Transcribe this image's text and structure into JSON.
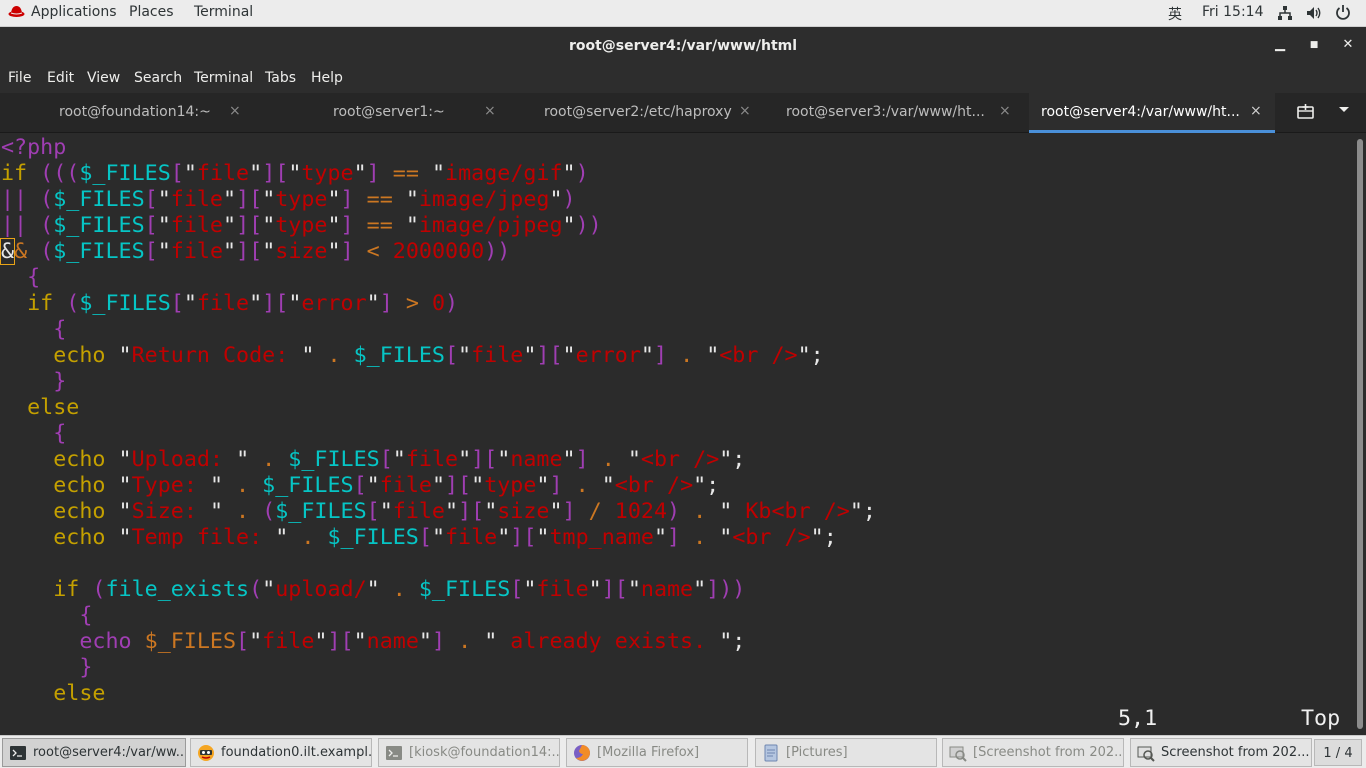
{
  "topbar": {
    "applications": "Applications",
    "places": "Places",
    "terminal": "Terminal",
    "input_method": "英",
    "clock": "Fri 15:14",
    "icons": [
      "network-icon",
      "volume-icon",
      "power-icon"
    ]
  },
  "window": {
    "title": "root@server4:/var/www/html",
    "minimize": "▁",
    "maximize": "■",
    "close": "✕"
  },
  "menubar": [
    "File",
    "Edit",
    "View",
    "Search",
    "Terminal",
    "Tabs",
    "Help"
  ],
  "tabs": [
    {
      "label": "root@foundation14:~",
      "active": false
    },
    {
      "label": "root@server1:~",
      "active": false
    },
    {
      "label": "root@server2:/etc/haproxy",
      "active": false
    },
    {
      "label": "root@server3:/var/www/ht...",
      "active": false
    },
    {
      "label": "root@server4:/var/www/ht...",
      "active": true
    }
  ],
  "tab_close": "×",
  "editor": {
    "lines": [
      [
        [
          "pu",
          "<?php"
        ]
      ],
      [
        [
          "ye",
          "if"
        ],
        [
          "pu",
          " ((("
        ],
        [
          "cy",
          "$_FILES"
        ],
        [
          "pu",
          "["
        ],
        [
          "wh",
          "\""
        ],
        [
          "re",
          "file"
        ],
        [
          "wh",
          "\""
        ],
        [
          "pu",
          "]["
        ],
        [
          "wh",
          "\""
        ],
        [
          "re",
          "type"
        ],
        [
          "wh",
          "\""
        ],
        [
          "pu",
          "]"
        ],
        [
          "or",
          " == "
        ],
        [
          "wh",
          "\""
        ],
        [
          "re",
          "image/gif"
        ],
        [
          "wh",
          "\""
        ],
        [
          "pu",
          ")"
        ]
      ],
      [
        [
          "pu",
          "|| ("
        ],
        [
          "cy",
          "$_FILES"
        ],
        [
          "pu",
          "["
        ],
        [
          "wh",
          "\""
        ],
        [
          "re",
          "file"
        ],
        [
          "wh",
          "\""
        ],
        [
          "pu",
          "]["
        ],
        [
          "wh",
          "\""
        ],
        [
          "re",
          "type"
        ],
        [
          "wh",
          "\""
        ],
        [
          "pu",
          "]"
        ],
        [
          "or",
          " == "
        ],
        [
          "wh",
          "\""
        ],
        [
          "re",
          "image/jpeg"
        ],
        [
          "wh",
          "\""
        ],
        [
          "pu",
          ")"
        ]
      ],
      [
        [
          "pu",
          "|| ("
        ],
        [
          "cy",
          "$_FILES"
        ],
        [
          "pu",
          "["
        ],
        [
          "wh",
          "\""
        ],
        [
          "re",
          "file"
        ],
        [
          "wh",
          "\""
        ],
        [
          "pu",
          "]["
        ],
        [
          "wh",
          "\""
        ],
        [
          "re",
          "type"
        ],
        [
          "wh",
          "\""
        ],
        [
          "pu",
          "]"
        ],
        [
          "or",
          " == "
        ],
        [
          "wh",
          "\""
        ],
        [
          "re",
          "image/pjpeg"
        ],
        [
          "wh",
          "\""
        ],
        [
          "pu",
          "))"
        ]
      ],
      [
        [
          "cur",
          "&"
        ],
        [
          "or",
          "& "
        ],
        [
          "pu",
          "("
        ],
        [
          "cy",
          "$_FILES"
        ],
        [
          "pu",
          "["
        ],
        [
          "wh",
          "\""
        ],
        [
          "re",
          "file"
        ],
        [
          "wh",
          "\""
        ],
        [
          "pu",
          "]["
        ],
        [
          "wh",
          "\""
        ],
        [
          "re",
          "size"
        ],
        [
          "wh",
          "\""
        ],
        [
          "pu",
          "]"
        ],
        [
          "or",
          " < "
        ],
        [
          "re",
          "2000000"
        ],
        [
          "pu",
          "))"
        ]
      ],
      [
        [
          "pu",
          "  {"
        ]
      ],
      [
        [
          "ye",
          "  if"
        ],
        [
          "pu",
          " ("
        ],
        [
          "cy",
          "$_FILES"
        ],
        [
          "pu",
          "["
        ],
        [
          "wh",
          "\""
        ],
        [
          "re",
          "file"
        ],
        [
          "wh",
          "\""
        ],
        [
          "pu",
          "]["
        ],
        [
          "wh",
          "\""
        ],
        [
          "re",
          "error"
        ],
        [
          "wh",
          "\""
        ],
        [
          "pu",
          "]"
        ],
        [
          "or",
          " > "
        ],
        [
          "re",
          "0"
        ],
        [
          "pu",
          ")"
        ]
      ],
      [
        [
          "pu",
          "    {"
        ]
      ],
      [
        [
          "ye",
          "    echo"
        ],
        [
          "wh",
          " \""
        ],
        [
          "re",
          "Return Code: "
        ],
        [
          "wh",
          "\""
        ],
        [
          "or",
          " . "
        ],
        [
          "cy",
          "$_FILES"
        ],
        [
          "pu",
          "["
        ],
        [
          "wh",
          "\""
        ],
        [
          "re",
          "file"
        ],
        [
          "wh",
          "\""
        ],
        [
          "pu",
          "]["
        ],
        [
          "wh",
          "\""
        ],
        [
          "re",
          "error"
        ],
        [
          "wh",
          "\""
        ],
        [
          "pu",
          "]"
        ],
        [
          "or",
          " . "
        ],
        [
          "wh",
          "\""
        ],
        [
          "re",
          "<br />"
        ],
        [
          "wh",
          "\";"
        ]
      ],
      [
        [
          "pu",
          "    }"
        ]
      ],
      [
        [
          "ye",
          "  else"
        ]
      ],
      [
        [
          "pu",
          "    {"
        ]
      ],
      [
        [
          "ye",
          "    echo"
        ],
        [
          "wh",
          " \""
        ],
        [
          "re",
          "Upload: "
        ],
        [
          "wh",
          "\""
        ],
        [
          "or",
          " . "
        ],
        [
          "cy",
          "$_FILES"
        ],
        [
          "pu",
          "["
        ],
        [
          "wh",
          "\""
        ],
        [
          "re",
          "file"
        ],
        [
          "wh",
          "\""
        ],
        [
          "pu",
          "]["
        ],
        [
          "wh",
          "\""
        ],
        [
          "re",
          "name"
        ],
        [
          "wh",
          "\""
        ],
        [
          "pu",
          "]"
        ],
        [
          "or",
          " . "
        ],
        [
          "wh",
          "\""
        ],
        [
          "re",
          "<br />"
        ],
        [
          "wh",
          "\";"
        ]
      ],
      [
        [
          "ye",
          "    echo"
        ],
        [
          "wh",
          " \""
        ],
        [
          "re",
          "Type: "
        ],
        [
          "wh",
          "\""
        ],
        [
          "or",
          " . "
        ],
        [
          "cy",
          "$_FILES"
        ],
        [
          "pu",
          "["
        ],
        [
          "wh",
          "\""
        ],
        [
          "re",
          "file"
        ],
        [
          "wh",
          "\""
        ],
        [
          "pu",
          "]["
        ],
        [
          "wh",
          "\""
        ],
        [
          "re",
          "type"
        ],
        [
          "wh",
          "\""
        ],
        [
          "pu",
          "]"
        ],
        [
          "or",
          " . "
        ],
        [
          "wh",
          "\""
        ],
        [
          "re",
          "<br />"
        ],
        [
          "wh",
          "\";"
        ]
      ],
      [
        [
          "ye",
          "    echo"
        ],
        [
          "wh",
          " \""
        ],
        [
          "re",
          "Size: "
        ],
        [
          "wh",
          "\""
        ],
        [
          "or",
          " . "
        ],
        [
          "pu",
          "("
        ],
        [
          "cy",
          "$_FILES"
        ],
        [
          "pu",
          "["
        ],
        [
          "wh",
          "\""
        ],
        [
          "re",
          "file"
        ],
        [
          "wh",
          "\""
        ],
        [
          "pu",
          "]["
        ],
        [
          "wh",
          "\""
        ],
        [
          "re",
          "size"
        ],
        [
          "wh",
          "\""
        ],
        [
          "pu",
          "]"
        ],
        [
          "or",
          " / "
        ],
        [
          "re",
          "1024"
        ],
        [
          "pu",
          ")"
        ],
        [
          "or",
          " . "
        ],
        [
          "wh",
          "\""
        ],
        [
          "re",
          " Kb<br />"
        ],
        [
          "wh",
          "\";"
        ]
      ],
      [
        [
          "ye",
          "    echo"
        ],
        [
          "wh",
          " \""
        ],
        [
          "re",
          "Temp file: "
        ],
        [
          "wh",
          "\""
        ],
        [
          "or",
          " . "
        ],
        [
          "cy",
          "$_FILES"
        ],
        [
          "pu",
          "["
        ],
        [
          "wh",
          "\""
        ],
        [
          "re",
          "file"
        ],
        [
          "wh",
          "\""
        ],
        [
          "pu",
          "]["
        ],
        [
          "wh",
          "\""
        ],
        [
          "re",
          "tmp_name"
        ],
        [
          "wh",
          "\""
        ],
        [
          "pu",
          "]"
        ],
        [
          "or",
          " . "
        ],
        [
          "wh",
          "\""
        ],
        [
          "re",
          "<br />"
        ],
        [
          "wh",
          "\";"
        ]
      ],
      [],
      [
        [
          "ye",
          "    if"
        ],
        [
          "pu",
          " ("
        ],
        [
          "cy",
          "file_exists"
        ],
        [
          "pu",
          "("
        ],
        [
          "wh",
          "\""
        ],
        [
          "re",
          "upload/"
        ],
        [
          "wh",
          "\""
        ],
        [
          "or",
          " . "
        ],
        [
          "cy",
          "$_FILES"
        ],
        [
          "pu",
          "["
        ],
        [
          "wh",
          "\""
        ],
        [
          "re",
          "file"
        ],
        [
          "wh",
          "\""
        ],
        [
          "pu",
          "]["
        ],
        [
          "wh",
          "\""
        ],
        [
          "re",
          "name"
        ],
        [
          "wh",
          "\""
        ],
        [
          "pu",
          "]))"
        ]
      ],
      [
        [
          "pu",
          "      {"
        ]
      ],
      [
        [
          "pu",
          "      echo"
        ],
        [
          "or",
          " $_FILES"
        ],
        [
          "pu",
          "["
        ],
        [
          "wh",
          "\""
        ],
        [
          "re",
          "file"
        ],
        [
          "wh",
          "\""
        ],
        [
          "pu",
          "]["
        ],
        [
          "wh",
          "\""
        ],
        [
          "re",
          "name"
        ],
        [
          "wh",
          "\""
        ],
        [
          "pu",
          "]"
        ],
        [
          "or",
          " . "
        ],
        [
          "wh",
          "\""
        ],
        [
          "re",
          " already exists. "
        ],
        [
          "wh",
          "\";"
        ]
      ],
      [
        [
          "pu",
          "      }"
        ]
      ],
      [
        [
          "ye",
          "    else"
        ]
      ]
    ],
    "position": "5,1",
    "scroll": "Top"
  },
  "taskbar": {
    "items": [
      {
        "label": "root@server4:/var/ww...",
        "icon": "terminal-icon",
        "current": true,
        "dim": false
      },
      {
        "label": "foundation0.ilt.exampl...",
        "icon": "document-viewer-icon",
        "current": false,
        "dim": false
      },
      {
        "label": "[kiosk@foundation14:...",
        "icon": "terminal-icon",
        "current": false,
        "dim": true
      },
      {
        "label": "[Mozilla Firefox]",
        "icon": "firefox-icon",
        "current": false,
        "dim": true
      },
      {
        "label": "[Pictures]",
        "icon": "folder-icon",
        "current": false,
        "dim": true
      },
      {
        "label": "[Screenshot from 202...",
        "icon": "screenshot-icon",
        "current": false,
        "dim": true
      },
      {
        "label": "Screenshot from 202...",
        "icon": "screenshot-icon",
        "current": false,
        "dim": false
      }
    ],
    "pager": "1 / 4"
  }
}
